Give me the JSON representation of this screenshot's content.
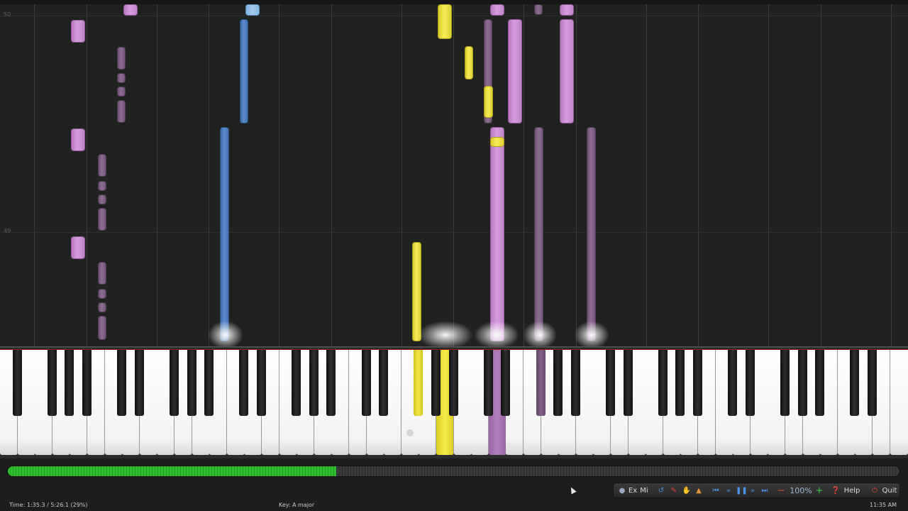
{
  "status": {
    "time_label": "Time:",
    "time_value": "1:35.3 / 5:26.1 (29%)",
    "key_label": "Key:",
    "key_value": "A major",
    "clock": "11:35 AM"
  },
  "playback": {
    "progress_fraction": 0.29
  },
  "measures": [
    "50",
    "49"
  ],
  "toolbar": {
    "ex_label": "Ex",
    "mi_label": "Mi",
    "zoom": "100%",
    "help_label": "Help",
    "quit_label": "Quit",
    "icons": [
      "settings-icon",
      "loop-icon",
      "pencil-icon",
      "hand-icon",
      "metronome-icon",
      "skip-start-icon",
      "rewind-icon",
      "pause-icon",
      "fast-forward-icon",
      "skip-end-icon",
      "zoom-out-icon",
      "zoom-in-icon",
      "help-icon",
      "quit-icon"
    ]
  },
  "colors": {
    "pink": "#d79ddf",
    "mauve": "#8e6c93",
    "blue": "#5d8cce",
    "light_blue": "#a5cbf0",
    "yellow": "#f6ee5a",
    "progress": "#2fbf2f"
  }
}
